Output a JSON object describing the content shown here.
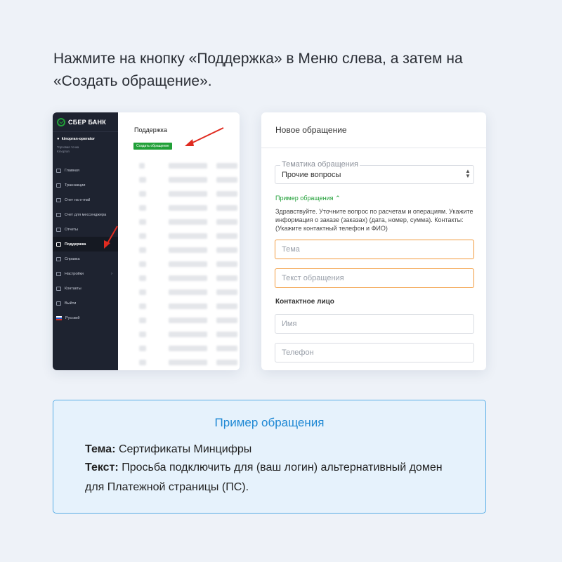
{
  "instruction": "Нажмите на кнопку «Поддержка» в Меню слева, а затем на «Создать обращение».",
  "left_screenshot": {
    "logo_text": "СБЕР БАНК",
    "user_name": "kinopran-operator",
    "user_sub": "Торговая точка Kinopran",
    "menu": [
      {
        "label": "Главная"
      },
      {
        "label": "Транзакции"
      },
      {
        "label": "Счет на e-mail"
      },
      {
        "label": "Счет для мессенджера"
      },
      {
        "label": "Отчеты"
      },
      {
        "label": "Поддержка"
      },
      {
        "label": "Справка"
      },
      {
        "label": "Настройки"
      },
      {
        "label": "Контакты"
      },
      {
        "label": "Выйти"
      },
      {
        "label": "Русский"
      }
    ],
    "content_title": "Поддержка",
    "create_button": "Создать обращение",
    "colors": {
      "brand": "#21a038",
      "sidebar": "#1e2330",
      "arrow": "#e02b20"
    }
  },
  "right_form": {
    "header": "Новое обращение",
    "topic_label": "Тематика обращения",
    "topic_value": "Прочие вопросы",
    "example_link": "Пример обращения",
    "example_text": "Здравствуйте. Уточните вопрос по расчетам и операциям. Укажите информация о заказе (заказах) (дата, номер, сумма). Контакты: (Укажите контактный телефон и ФИО)",
    "subject_placeholder": "Тема",
    "body_placeholder": "Текст обращения",
    "contact_section": "Контактное лицо",
    "name_placeholder": "Имя",
    "phone_placeholder": "Телефон",
    "colors": {
      "highlight": "#f29a3c",
      "link": "#21a038"
    }
  },
  "example_box": {
    "title": "Пример обращения",
    "subject_label": "Тема:",
    "subject_value": "Сертификаты Минцифры",
    "text_label": "Текст:",
    "text_value": "Просьба подключить для (ваш логин) альтернативный домен для Платежной страницы (ПС).",
    "colors": {
      "title": "#1e88d4",
      "border": "#5aaee6",
      "background": "#e6f2fc"
    }
  }
}
